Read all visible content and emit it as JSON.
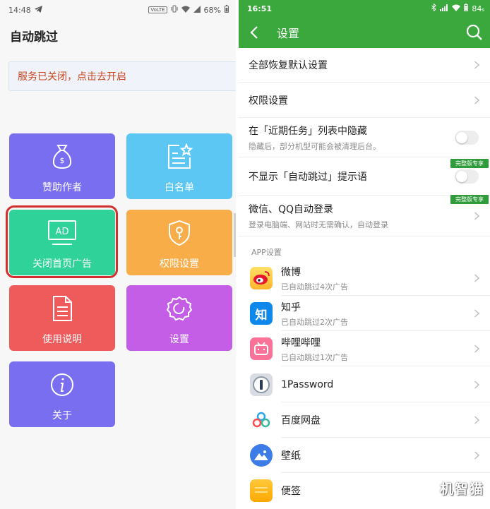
{
  "left": {
    "status": {
      "time": "14:48",
      "network_badge": "VoLTE",
      "battery": "68%"
    },
    "title": "自动跳过",
    "notice": "服务已关闭，点击去开启",
    "tiles": [
      {
        "label": "赞助作者",
        "icon": "money-bag-icon",
        "color": "#7a6ef0"
      },
      {
        "label": "白名单",
        "icon": "list-star-icon",
        "color": "#5cc7f2"
      },
      {
        "label": "关闭首页广告",
        "icon": "ad-screen-icon",
        "color": "#2fd39a",
        "highlighted": true,
        "ad_text": "AD"
      },
      {
        "label": "权限设置",
        "icon": "shield-key-icon",
        "color": "#f9ad49"
      },
      {
        "label": "使用说明",
        "icon": "document-icon",
        "color": "#ef5b5b"
      },
      {
        "label": "设置",
        "icon": "gear-icon",
        "color": "#c45ee6"
      },
      {
        "label": "关于",
        "icon": "info-icon",
        "color": "#7a6ef0"
      }
    ]
  },
  "right": {
    "status": {
      "time": "16:51",
      "battery": "84"
    },
    "bar_title": "设置",
    "accent": "#3aa83c",
    "rows": [
      {
        "title": "全部恢复默认设置"
      },
      {
        "title": "权限设置"
      },
      {
        "title": "在「近期任务」列表中隐藏",
        "sub": "隐藏后，部分机型可能会被清理后台。",
        "toggle": false
      },
      {
        "title": "不显示「自动跳过」提示语",
        "toggle": false,
        "badge": "完整版专享"
      },
      {
        "title": "微信、QQ自动登录",
        "sub": "登录电脑端、网站时无需确认，自动登录",
        "badge": "完整版专享"
      }
    ],
    "section_label": "APP设置",
    "apps": [
      {
        "name": "微博",
        "sub": "已自动跳过4次广告",
        "icon": "weibo-icon"
      },
      {
        "name": "知乎",
        "sub": "已自动跳过2次广告",
        "icon": "zhihu-icon",
        "glyph": "知"
      },
      {
        "name": "哔哩哔哩",
        "sub": "已自动跳过1次广告",
        "icon": "bilibili-icon"
      },
      {
        "name": "1Password",
        "icon": "1password-icon"
      },
      {
        "name": "百度网盘",
        "icon": "baidu-netdisk-icon"
      },
      {
        "name": "壁纸",
        "icon": "wallpaper-icon"
      },
      {
        "name": "便签",
        "icon": "notes-icon"
      }
    ],
    "watermark": "机智猫"
  }
}
